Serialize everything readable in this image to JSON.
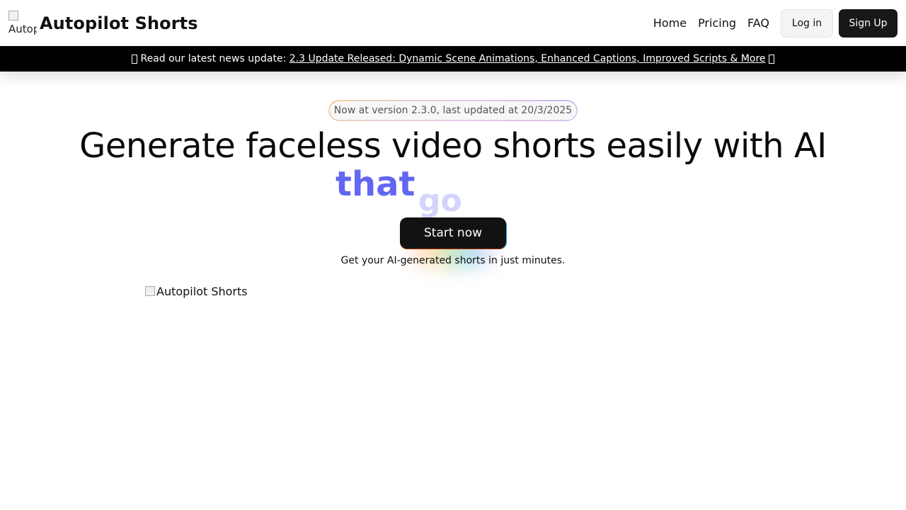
{
  "header": {
    "logo_alt": "Autopilot Shorts",
    "logo_visible_text": "Autop",
    "brand_name": "Autopilot Shorts",
    "nav": [
      {
        "label": "Home"
      },
      {
        "label": "Pricing"
      },
      {
        "label": "FAQ"
      }
    ],
    "login_label": "Log in",
    "signup_label": "Sign Up"
  },
  "announcement": {
    "prefix": "Read our latest news update:",
    "link_text": "2.3 Update Released: Dynamic Scene Animations, Enhanced Captions, Improved Scripts & More",
    "leading_icon": "missing-glyph-icon",
    "trailing_icon": "missing-glyph-icon"
  },
  "hero": {
    "version_text": "Now at version 2.3.0, last updated at 20/3/2025",
    "headline": "Generate faceless video shorts easily with AI",
    "animated_words": [
      "that",
      "go"
    ],
    "cta_label": "Start now",
    "subtext": "Get your AI-generated shorts in just minutes.",
    "hero_image_alt": "Autopilot Shorts"
  },
  "colors": {
    "accent": "#6366f1",
    "accent_faded": "#d4d3fb",
    "dark_button": "#18181b",
    "announcement_bg": "#000000"
  }
}
